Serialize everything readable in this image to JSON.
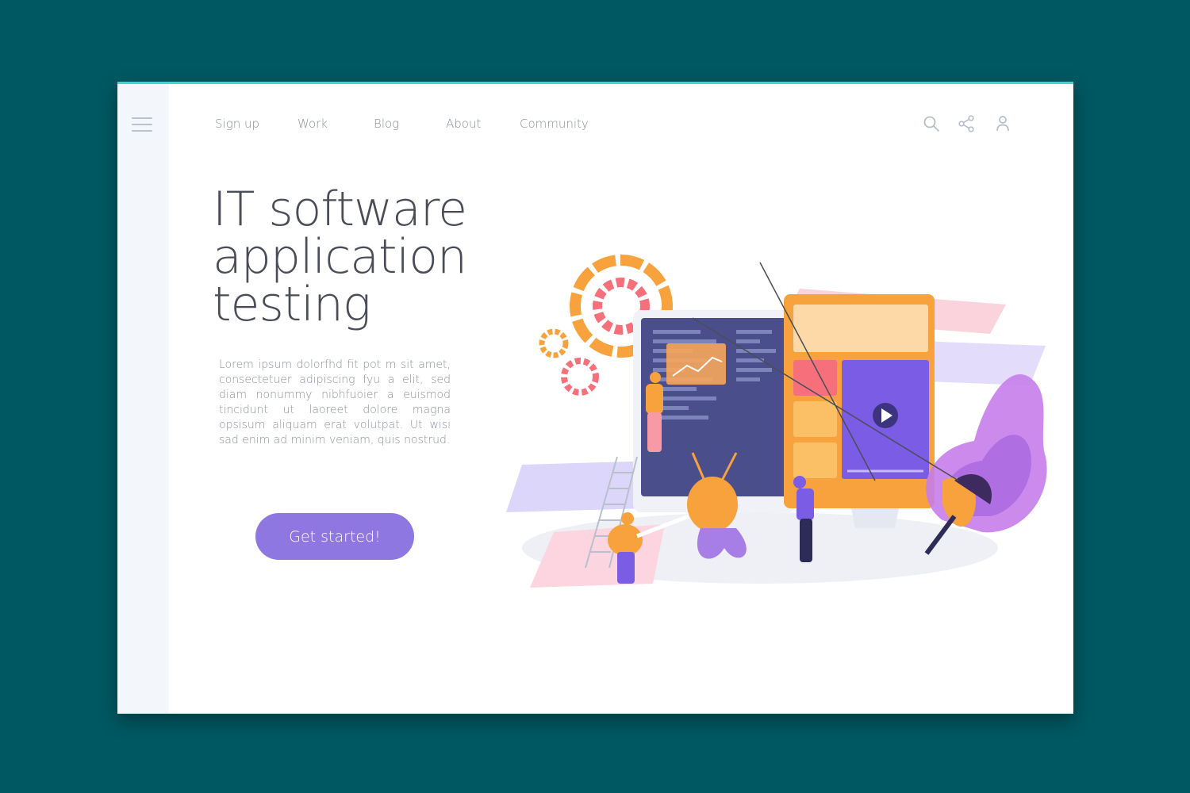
{
  "nav": {
    "items": [
      {
        "label": "Sign up"
      },
      {
        "label": "Work"
      },
      {
        "label": "Blog"
      },
      {
        "label": "About"
      },
      {
        "label": "Community"
      }
    ]
  },
  "header_icons": [
    "search-icon",
    "share-icon",
    "user-icon"
  ],
  "hero": {
    "title_lines": [
      "IT software",
      "application",
      "testing"
    ],
    "body": "Lorem ipsum dolorfhd fit pot m sit amet, consectetuer adipiscing fyu  a elit, sed diam nonummy nibhfuoier a euismod tincidunt ut laoreet dolore magna opsisum aliquam erat volutpat. Ut wisi sad enim ad minim veniam, quis nostrud.",
    "cta_label": "Get started!"
  },
  "colors": {
    "background": "#005862",
    "accent_button": "#8f77e2",
    "top_border": "#3fd6cf",
    "orange": "#f7a23c",
    "purple": "#7b5ce5",
    "pink": "#f7b3c0"
  }
}
